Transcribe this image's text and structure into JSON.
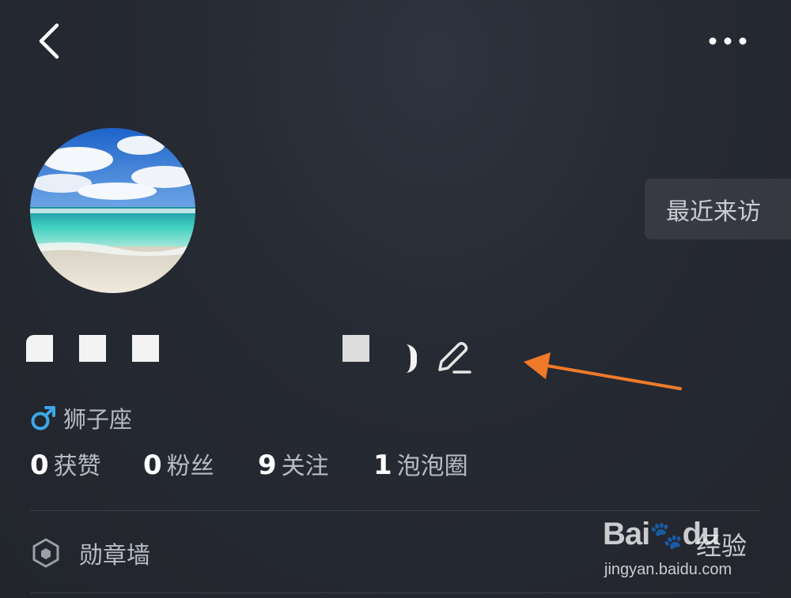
{
  "header": {
    "back_icon": "chevron-left-icon",
    "more_icon": "ellipsis-icon"
  },
  "profile": {
    "avatar_image": "beach-scene",
    "recent_visitors_label": "最近来访",
    "edit_icon": "pencil-icon",
    "gender_icon": "male-icon",
    "gender_color": "#3aa8e8",
    "zodiac": "狮子座"
  },
  "stats": [
    {
      "value": "0",
      "label": "获赞"
    },
    {
      "value": "0",
      "label": "粉丝"
    },
    {
      "value": "9",
      "label": "关注"
    },
    {
      "value": "1",
      "label": "泡泡圈"
    }
  ],
  "menu": {
    "medal_wall_icon": "hexagon-badge-icon",
    "medal_wall_label": "勋章墙"
  },
  "annotation": {
    "arrow_color": "#f07a2a"
  },
  "watermark": {
    "logo_text": "Bai",
    "logo_text_2": "du",
    "brand_cn": "经验",
    "url": "jingyan.baidu.com"
  }
}
